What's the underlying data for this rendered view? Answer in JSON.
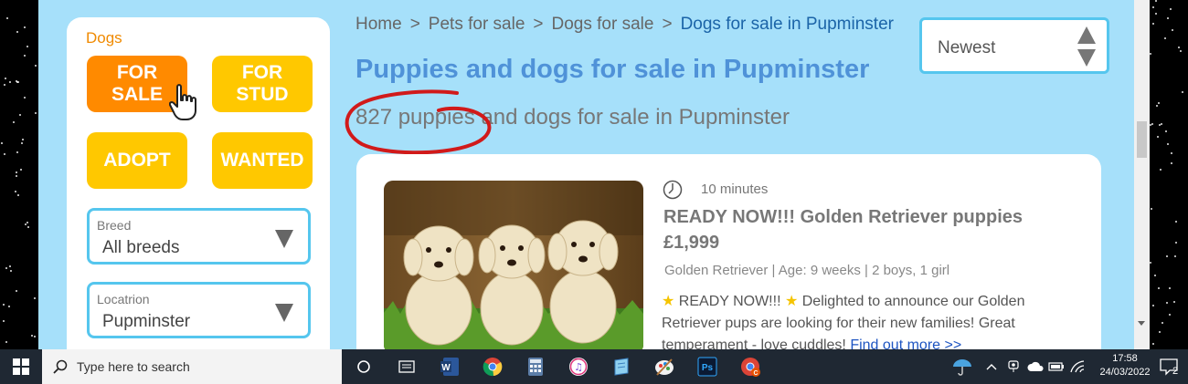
{
  "sidebar": {
    "heading": "Dogs",
    "categories": [
      {
        "label": "FOR\nSALE",
        "active": true
      },
      {
        "label": "FOR\nSTUD",
        "active": false
      },
      {
        "label": "ADOPT",
        "active": false
      },
      {
        "label": "WANTED",
        "active": false
      }
    ],
    "breed": {
      "label": "Breed",
      "value": "All breeds"
    },
    "location": {
      "label": "Locatrion",
      "value": "Pupminster"
    }
  },
  "breadcrumb": [
    "Home",
    "Pets for sale",
    "Dogs for sale",
    "Dogs for sale in Pupminster"
  ],
  "breadcrumb_separator": ">",
  "page_title": "Puppies and dogs for sale in Pupminster",
  "count_line": "827 puppies and dogs for sale in Pupminster",
  "sort": {
    "value": "Newest"
  },
  "listing": {
    "time": "10 minutes",
    "title": "READY NOW!!! Golden Retriever puppies",
    "price": "£1,999",
    "meta": "Golden Retriever  | Age: 9 weeks | 2 boys, 1 girl",
    "star": "★",
    "desc_part1": " READY NOW!!! ",
    "desc_part2": " Delighted to announce our Golden Retriever pups are looking for their new families! Great temperament - love cuddles! ",
    "link": "Find out more >>"
  },
  "taskbar": {
    "search_placeholder": "Type here to search",
    "time": "17:58",
    "date": "24/03/2022",
    "notification_count": "2",
    "apps": [
      "task-view",
      "word",
      "chrome",
      "calculator",
      "itunes",
      "notepad",
      "paint",
      "photoshop",
      "chrome-alt"
    ]
  },
  "colors": {
    "page_bg": "#a6e0fa",
    "accent_orange": "#ff8a00",
    "accent_yellow": "#ffc800",
    "title_blue": "#4f92d8",
    "annotation_red": "#d11a1a"
  }
}
